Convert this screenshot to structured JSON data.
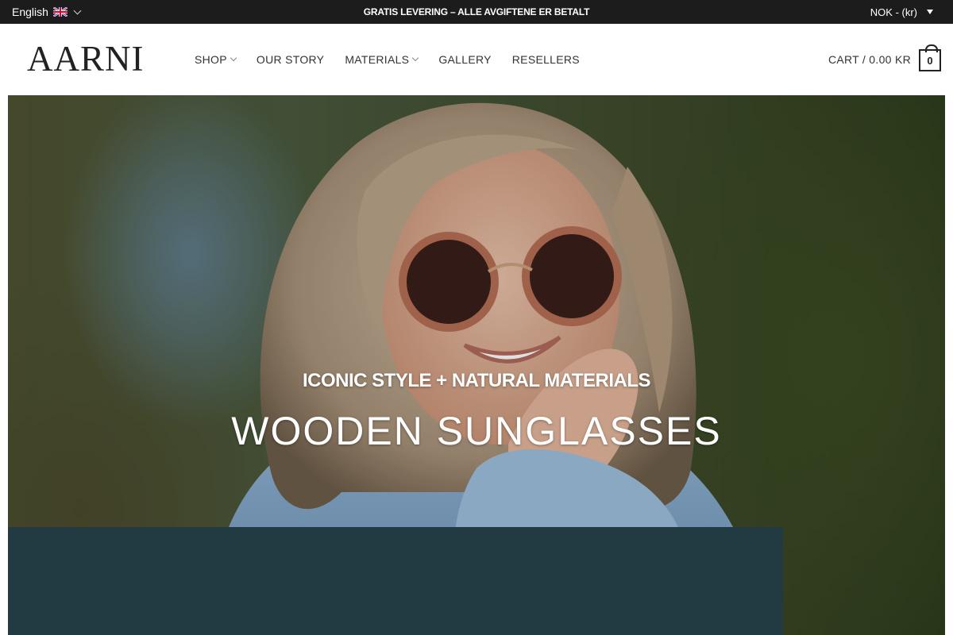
{
  "topbar": {
    "language": "English",
    "language_flag_icon": "uk-flag-icon",
    "promo": "GRATIS LEVERING – ALLE AVGIFTENE ER BETALT",
    "currency": "NOK - (kr)"
  },
  "header": {
    "logo": "AARNI",
    "nav": [
      {
        "label": "SHOP",
        "has_dropdown": true
      },
      {
        "label": "OUR STORY",
        "has_dropdown": false
      },
      {
        "label": "MATERIALS",
        "has_dropdown": true
      },
      {
        "label": "GALLERY",
        "has_dropdown": false
      },
      {
        "label": "RESELLERS",
        "has_dropdown": false
      }
    ],
    "cart_label": "CART / 0.00 KR",
    "cart_count": "0"
  },
  "hero": {
    "kicker": "ICONIC STYLE + NATURAL MATERIALS",
    "title": "WOODEN SUNGLASSES"
  },
  "colors": {
    "topbar_bg": "#1c1c1c",
    "panel_bg": "#223a41",
    "text_dark": "#222222"
  }
}
